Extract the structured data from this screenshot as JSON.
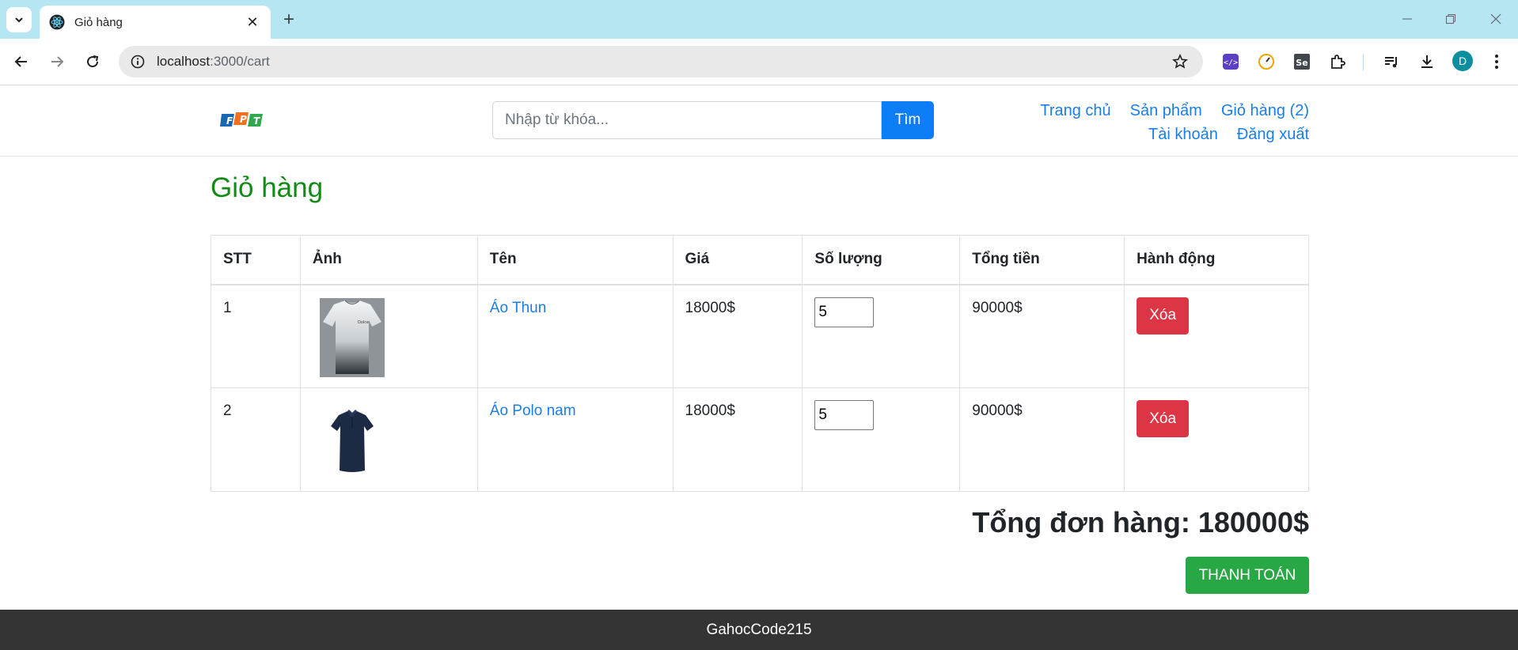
{
  "browser": {
    "tab_title": "Giỏ hàng",
    "url_host": "localhost",
    "url_rest": ":3000/cart",
    "avatar_letter": "D"
  },
  "header": {
    "logo_text": "FPT",
    "search_placeholder": "Nhập từ khóa...",
    "search_button": "Tìm",
    "nav_row1": [
      "Trang chủ",
      "Sản phẩm",
      "Giỏ hàng (2)"
    ],
    "nav_row2": [
      "Tài khoản",
      "Đăng xuất"
    ]
  },
  "main": {
    "title": "Giỏ hàng",
    "columns": [
      "STT",
      "Ảnh",
      "Tên",
      "Giá",
      "Số lượng",
      "Tổng tiền",
      "Hành động"
    ],
    "rows": [
      {
        "stt": "1",
        "name": "Áo Thun",
        "price": "18000$",
        "qty": "5",
        "total": "90000$",
        "action": "Xóa",
        "image": "white-tshirt"
      },
      {
        "stt": "2",
        "name": "Áo Polo nam",
        "price": "18000$",
        "qty": "5",
        "total": "90000$",
        "action": "Xóa",
        "image": "navy-polo"
      }
    ],
    "order_total": "Tổng đơn hàng: 180000$",
    "checkout_button": "THANH TOÁN"
  },
  "footer": {
    "text": "GahocCode215"
  },
  "colors": {
    "tab_bar": "#b5e6f2",
    "title_green": "#118a16",
    "link_blue": "#1a7ee6",
    "delete_red": "#dc3545",
    "checkout_green": "#28a745",
    "search_blue": "#0d7df6",
    "footer_bg": "#343434"
  }
}
